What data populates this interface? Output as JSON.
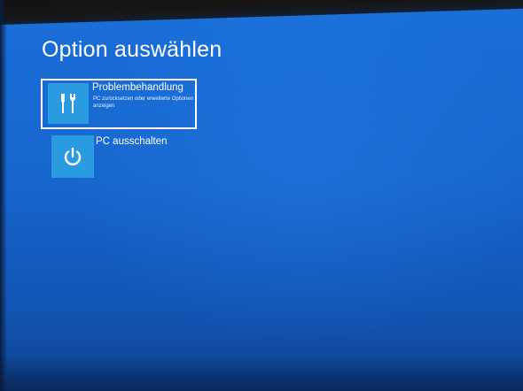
{
  "screen": {
    "title": "Option auswählen",
    "background_color": "#1766cf",
    "tile_color": "#2a9be0"
  },
  "options": [
    {
      "title": "Problembehandlung",
      "description": "PC zurücksetzen oder erweiterte Optionen anzeigen",
      "icon": "tools-icon",
      "selected": true
    },
    {
      "title": "PC ausschalten",
      "description": "",
      "icon": "power-icon",
      "selected": false
    }
  ]
}
